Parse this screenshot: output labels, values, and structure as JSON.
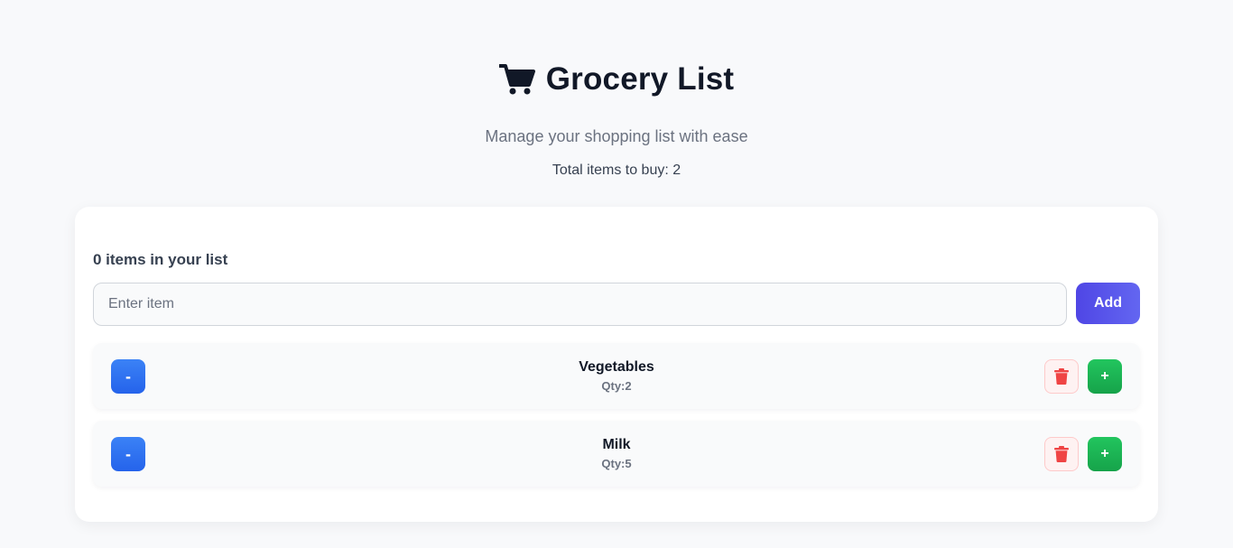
{
  "header": {
    "icon": "shopping-cart-icon",
    "title": "Grocery List",
    "subtitle": "Manage your shopping list with ease",
    "total_label": "Total items to buy: 2"
  },
  "list_panel": {
    "count_label": "0 items in your list",
    "input": {
      "placeholder": "Enter item",
      "value": ""
    },
    "add_label": "Add",
    "items": [
      {
        "name": "Vegetables",
        "qty_prefix": "Qty:",
        "qty": "2",
        "minus_label": "-",
        "plus_label": "+",
        "delete_icon": "trash-icon"
      },
      {
        "name": "Milk",
        "qty_prefix": "Qty:",
        "qty": "5",
        "minus_label": "-",
        "plus_label": "+",
        "delete_icon": "trash-icon"
      }
    ]
  },
  "colors": {
    "accent": "#4f46e5",
    "minus": "#2563eb",
    "plus": "#16a34a",
    "delete": "#ef4444",
    "background": "#f8f9fb"
  }
}
